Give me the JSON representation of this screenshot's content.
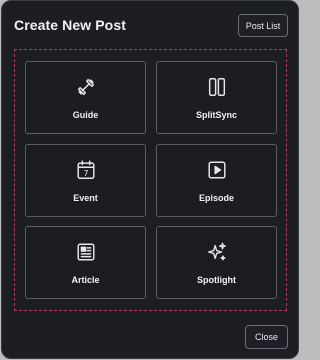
{
  "dialog": {
    "title": "Create New Post",
    "post_list_label": "Post List",
    "close_label": "Close"
  },
  "tiles": [
    {
      "label": "Guide",
      "icon": "dumbbell-icon"
    },
    {
      "label": "SplitSync",
      "icon": "columns-icon"
    },
    {
      "label": "Event",
      "icon": "calendar-icon",
      "icon_text": "7"
    },
    {
      "label": "Episode",
      "icon": "play-icon"
    },
    {
      "label": "Article",
      "icon": "article-icon"
    },
    {
      "label": "Spotlight",
      "icon": "sparkles-icon"
    }
  ],
  "colors": {
    "background": "#1d1e22",
    "dashed_border": "#b5336f",
    "tile_border": "#5a5d66",
    "text": "#f1f1f3"
  }
}
